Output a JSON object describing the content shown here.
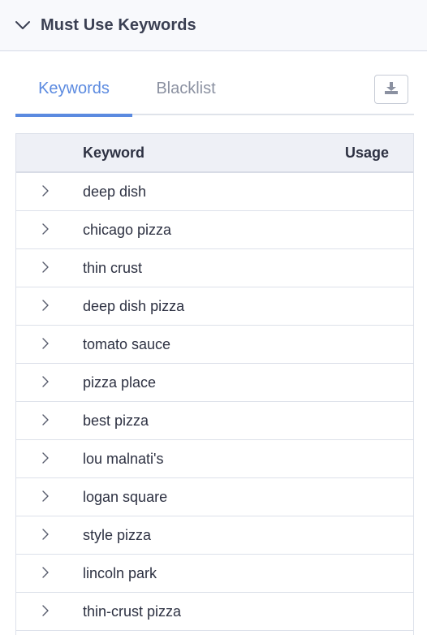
{
  "section": {
    "title": "Must Use Keywords",
    "collapse_icon": "chevron-down-icon"
  },
  "tabs": [
    {
      "label": "Keywords",
      "active": true
    },
    {
      "label": "Blacklist",
      "active": false
    }
  ],
  "download_icon": "download-icon",
  "table": {
    "headers": {
      "keyword": "Keyword",
      "usage": "Usage"
    },
    "rows": [
      {
        "keyword": "deep dish"
      },
      {
        "keyword": "chicago pizza"
      },
      {
        "keyword": "thin crust"
      },
      {
        "keyword": "deep dish pizza"
      },
      {
        "keyword": "tomato sauce"
      },
      {
        "keyword": "pizza place"
      },
      {
        "keyword": "best pizza"
      },
      {
        "keyword": "lou malnati's"
      },
      {
        "keyword": "logan square"
      },
      {
        "keyword": "style pizza"
      },
      {
        "keyword": "lincoln park"
      },
      {
        "keyword": "thin-crust pizza"
      }
    ]
  },
  "colors": {
    "accent": "#5b8ae0",
    "muted_tab": "#8b91a1",
    "header_bg": "#eef0f6",
    "border": "#dde1ea"
  }
}
